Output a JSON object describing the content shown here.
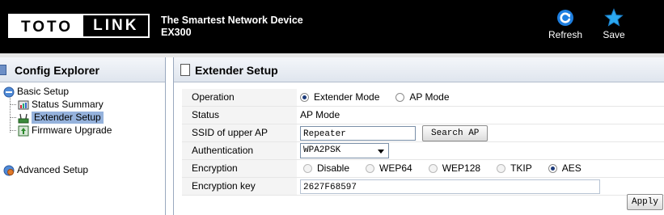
{
  "header": {
    "logo_left": "TOTO",
    "logo_right": "LINK",
    "tagline": "The Smartest Network Device",
    "model": "EX300",
    "refresh_label": "Refresh",
    "save_label": "Save",
    "refresh_icon": "refresh-icon",
    "save_icon": "star-icon",
    "accent_color": "#1e90ff"
  },
  "sidebar": {
    "title": "Config Explorer",
    "basic_setup": "Basic Setup",
    "items": [
      {
        "label": "Status Summary",
        "icon": "status-summary-icon"
      },
      {
        "label": "Extender Setup",
        "icon": "extender-setup-icon",
        "selected": true
      },
      {
        "label": "Firmware Upgrade",
        "icon": "firmware-upgrade-icon"
      }
    ],
    "advanced_setup": "Advanced Setup",
    "selected_color": "#95b2dc"
  },
  "main": {
    "title": "Extender Setup",
    "operation": {
      "label": "Operation",
      "options": [
        "Extender Mode",
        "AP Mode"
      ],
      "selected": "Extender Mode"
    },
    "status": {
      "label": "Status",
      "value": "AP Mode"
    },
    "ssid": {
      "label": "SSID of upper AP",
      "value": "Repeater",
      "search_button": "Search AP"
    },
    "authentication": {
      "label": "Authentication",
      "value": "WPA2PSK"
    },
    "encryption": {
      "label": "Encryption",
      "options": [
        "Disable",
        "WEP64",
        "WEP128",
        "TKIP",
        "AES"
      ],
      "selected": "AES"
    },
    "encryption_key": {
      "label": "Encryption key",
      "value": "2627F68597"
    },
    "apply_button": "Apply"
  }
}
